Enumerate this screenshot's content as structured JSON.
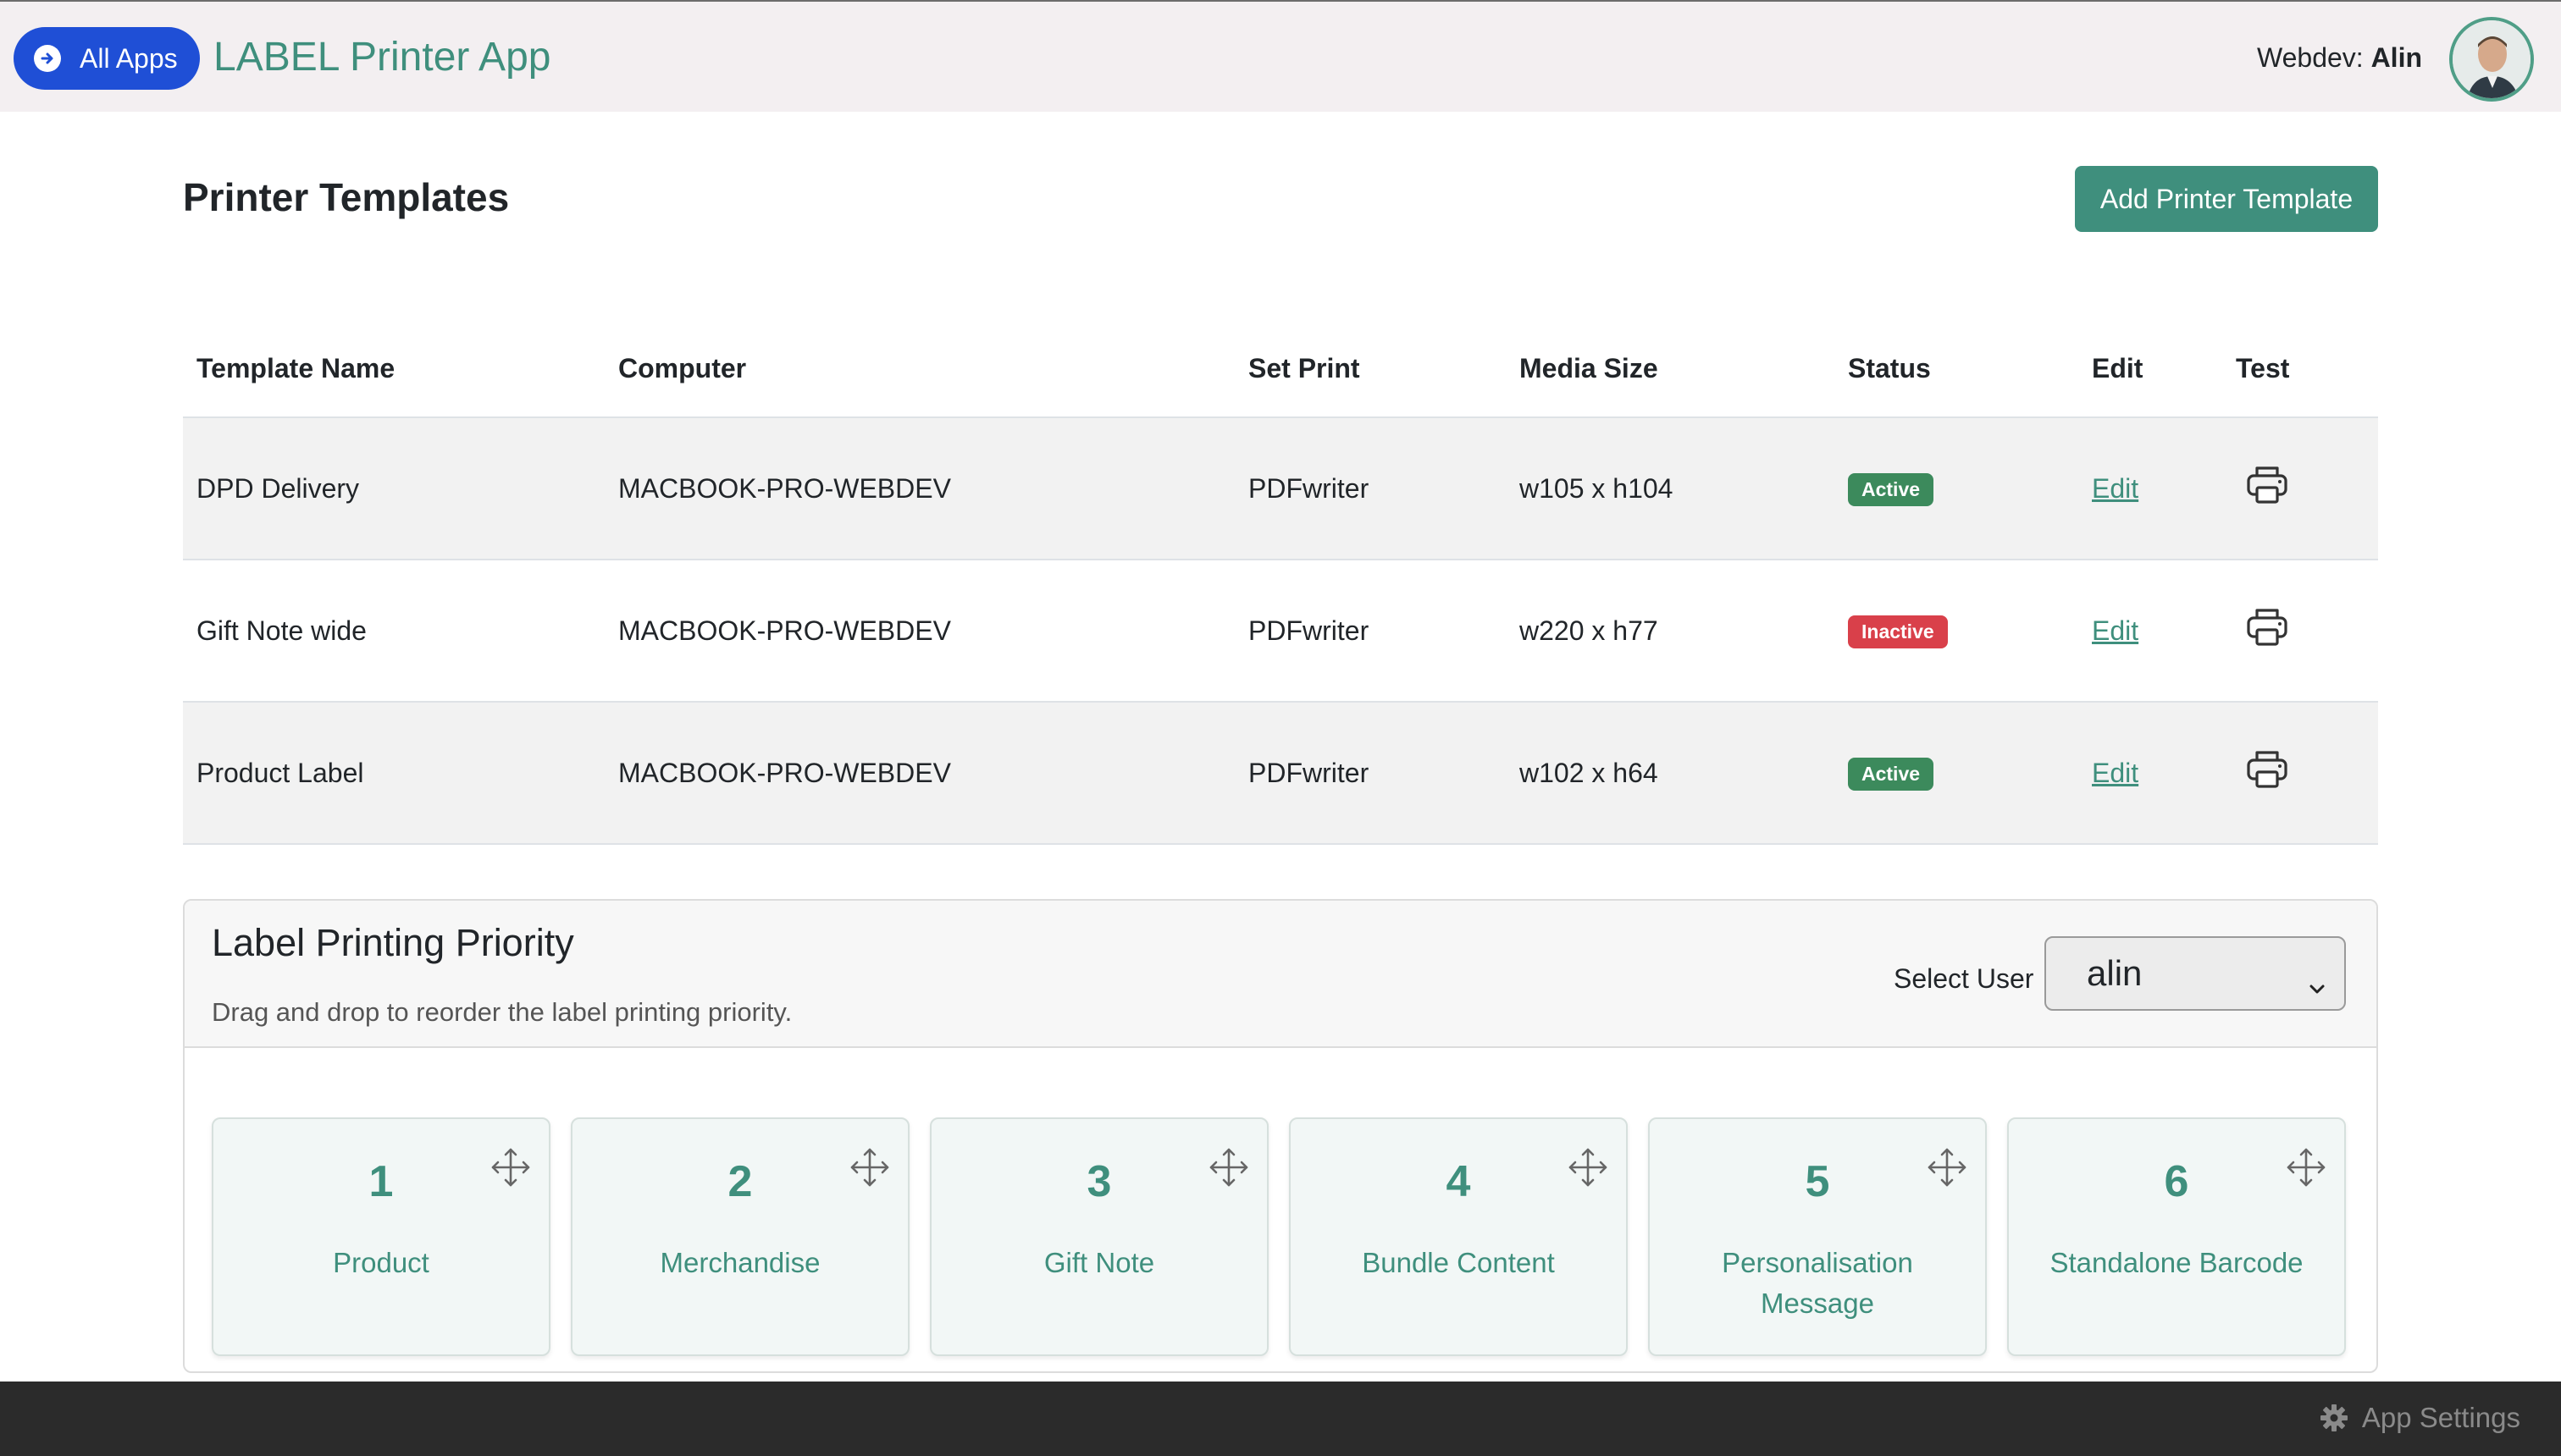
{
  "header": {
    "all_apps_label": "All Apps",
    "app_title": "LABEL Printer App",
    "user_prefix": "Webdev:",
    "user_name": "Alin"
  },
  "page": {
    "title": "Printer Templates",
    "add_button": "Add Printer Template"
  },
  "table": {
    "columns": [
      "Template Name",
      "Computer",
      "Set Print",
      "Media Size",
      "Status",
      "Edit",
      "Test"
    ],
    "rows": [
      {
        "name": "DPD Delivery",
        "computer": "MACBOOK-PRO-WEBDEV",
        "set_print": "PDFwriter",
        "media": "w105 x h104",
        "status": "Active",
        "edit": "Edit"
      },
      {
        "name": "Gift Note wide",
        "computer": "MACBOOK-PRO-WEBDEV",
        "set_print": "PDFwriter",
        "media": "w220 x h77",
        "status": "Inactive",
        "edit": "Edit"
      },
      {
        "name": "Product Label",
        "computer": "MACBOOK-PRO-WEBDEV",
        "set_print": "PDFwriter",
        "media": "w102 x h64",
        "status": "Active",
        "edit": "Edit"
      }
    ]
  },
  "priority": {
    "title": "Label Printing Priority",
    "subtitle": "Drag and drop to reorder the label printing priority.",
    "select_label": "Select User",
    "select_value": "alin",
    "items": [
      {
        "num": "1",
        "label": "Product"
      },
      {
        "num": "2",
        "label": "Merchandise"
      },
      {
        "num": "3",
        "label": "Gift Note"
      },
      {
        "num": "4",
        "label": "Bundle Content"
      },
      {
        "num": "5",
        "label": "Personalisation Message"
      },
      {
        "num": "6",
        "label": "Standalone Barcode"
      }
    ]
  },
  "footer": {
    "settings_label": "App Settings"
  },
  "colors": {
    "accent": "#3f8f7d",
    "primary_blue": "#1f4fd6",
    "active": "#3c8a5c",
    "inactive": "#d9404a"
  }
}
